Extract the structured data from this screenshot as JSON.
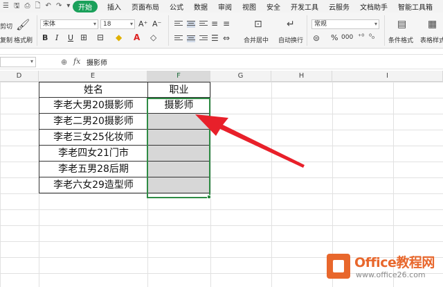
{
  "menu": {
    "quick_access": [
      "☰",
      "🖫",
      "⎙",
      "🗋",
      "↶",
      "↷",
      "▾"
    ],
    "tabs": [
      "开始",
      "插入",
      "页面布局",
      "公式",
      "数据",
      "审阅",
      "视图",
      "安全",
      "开发工具",
      "云服务",
      "文档助手",
      "智能工具箱"
    ],
    "active_tab": "开始"
  },
  "ribbon": {
    "cut_label": "剪切",
    "copy_label": "复制",
    "format_painter_label": "格式刷",
    "font_name": "宋体",
    "font_size": "18",
    "font_grow": "A⁺",
    "font_shrink": "A⁻",
    "bold": "B",
    "italic": "I",
    "underline": "U",
    "merge_center_label": "合并居中",
    "wrap_text_label": "自动换行",
    "number_format": "常规",
    "percent": "%",
    "thousands": "000",
    "cond_format_label": "条件格式",
    "table_style_label": "表格样式"
  },
  "formula_bar": {
    "name_box": "",
    "fx": "fx",
    "content": "摄影师"
  },
  "sheet": {
    "columns": [
      "D",
      "E",
      "F",
      "G",
      "H",
      "I"
    ],
    "active_column": "F",
    "header_name": "姓名",
    "header_job": "职业",
    "rows": [
      {
        "name": "李老大男20摄影师",
        "job": "摄影师"
      },
      {
        "name": "李老二男20摄影师",
        "job": ""
      },
      {
        "name": "李老三女25化妆师",
        "job": ""
      },
      {
        "name": "李老四女21门市",
        "job": ""
      },
      {
        "name": "李老五男28后期",
        "job": ""
      },
      {
        "name": "李老六女29造型师",
        "job": ""
      }
    ]
  },
  "watermark": {
    "name": "Office教程网",
    "url": "www.office26.com"
  },
  "colors": {
    "accent": "#1aa05a",
    "selection": "#2e8b44",
    "arrow": "#e8202a",
    "logo": "#e8672c"
  }
}
